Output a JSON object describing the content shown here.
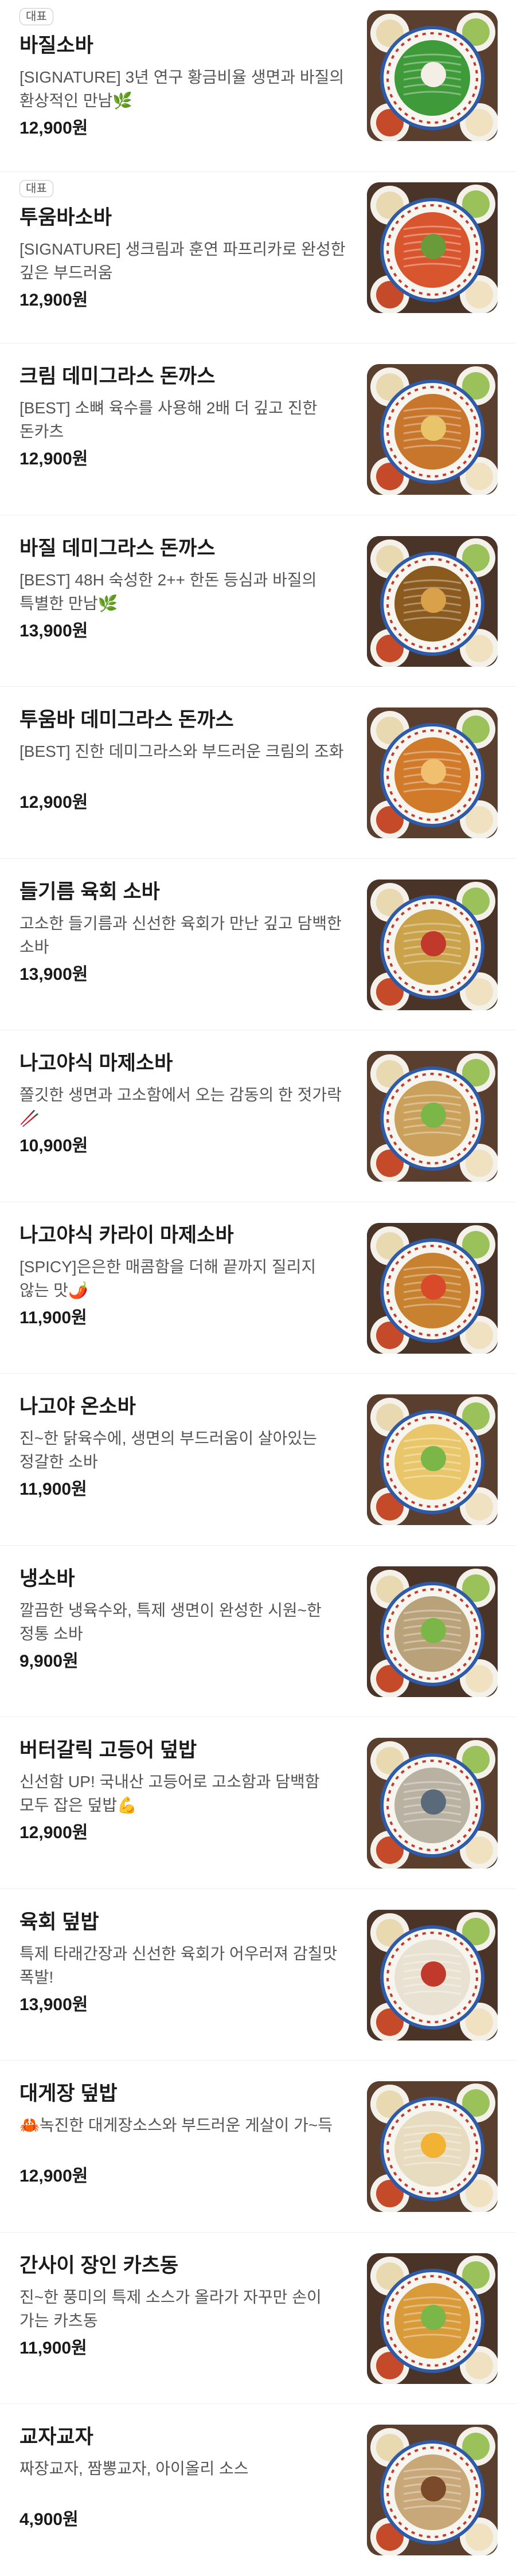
{
  "menu": {
    "items": [
      {
        "badge": "대표",
        "name": "바질소바",
        "desc": "[SIGNATURE] 3년 연구 황금비율 생면과 바질의 환상적인 만남🌿",
        "price": "12,900원",
        "food_color": "#3f9a3a",
        "topping_color": "#f3efe6",
        "image": "basil-soba-image"
      },
      {
        "badge": "대표",
        "name": "투움바소바",
        "desc": "[SIGNATURE] 생크림과 훈연 파프리카로 완성한 깊은 부드러움",
        "price": "12,900원",
        "food_color": "#d9552e",
        "topping_color": "#6a9b3a",
        "image": "toowoomba-soba-image"
      },
      {
        "badge": "",
        "name": "크림 데미그라스 돈까스",
        "desc": "[BEST] 소뼈 육수를 사용해 2배 더 깊고 진한 돈카츠",
        "price": "12,900원",
        "food_color": "#c8762c",
        "topping_color": "#e8c46a",
        "image": "cream-demiglace-tonkatsu-image"
      },
      {
        "badge": "",
        "name": "바질 데미그라스 돈까스",
        "desc": "[BEST] 48H 숙성한 2++ 한돈 등심과 바질의 특별한 만남🌿",
        "price": "13,900원",
        "food_color": "#8a5a1e",
        "topping_color": "#d9a24a",
        "image": "basil-demiglace-tonkatsu-image"
      },
      {
        "badge": "",
        "name": "투움바 데미그라스 돈까스",
        "desc": "[BEST] 진한 데미그라스와 부드러운 크림의 조화",
        "price": "12,900원",
        "food_color": "#d07a2a",
        "topping_color": "#f0c070",
        "image": "toowoomba-demiglace-tonkatsu-image"
      },
      {
        "badge": "",
        "name": "들기름 육회 소바",
        "desc": "고소한 들기름과 신선한 육회가 만난 깊고 담백한 소바",
        "price": "13,900원",
        "food_color": "#c9a24a",
        "topping_color": "#c0392b",
        "image": "perilla-yukhoe-soba-image"
      },
      {
        "badge": "",
        "name": "나고야식 마제소바",
        "desc": "쫄깃한 생면과 고소함에서 오는 감동의 한 젓가락🥢",
        "price": "10,900원",
        "food_color": "#caa05a",
        "topping_color": "#7ab648",
        "image": "nagoya-mazesoba-image"
      },
      {
        "badge": "",
        "name": "나고야식 카라이 마제소바",
        "desc": "[SPICY]은은한 매콤함을 더해 끝까지 질리지 않는 맛🌶️",
        "price": "11,900원",
        "food_color": "#c7812f",
        "topping_color": "#d94a2a",
        "image": "nagoya-karai-mazesoba-image"
      },
      {
        "badge": "",
        "name": "나고야 온소바",
        "desc": "진~한 닭육수에, 생면의 부드러움이 살아있는 정갈한 소바",
        "price": "11,900원",
        "food_color": "#e9c66a",
        "topping_color": "#7ab648",
        "image": "nagoya-onsoba-image"
      },
      {
        "badge": "",
        "name": "냉소바",
        "desc": "깔끔한 냉육수와, 특제 생면이 완성한 시원~한 정통 소바",
        "price": "9,900원",
        "food_color": "#b9a27a",
        "topping_color": "#7ab648",
        "image": "cold-soba-image"
      },
      {
        "badge": "",
        "name": "버터갈릭 고등어 덮밥",
        "desc": "신선함 UP! 국내산 고등어로 고소함과 담백함 모두 잡은 덮밥💪",
        "price": "12,900원",
        "food_color": "#b9b2a2",
        "topping_color": "#5a6a7a",
        "image": "butter-garlic-mackerel-bowl-image"
      },
      {
        "badge": "",
        "name": "육회 덮밥",
        "desc": "특제 타래간장과 신선한 육회가 어우러져 감칠맛 폭발!",
        "price": "13,900원",
        "food_color": "#e9e2d2",
        "topping_color": "#c0392b",
        "image": "yukhoe-bowl-image"
      },
      {
        "badge": "",
        "name": "대게장 덮밥",
        "desc": "🦀녹진한 대게장소스와 부드러운 게살이 가~득",
        "price": "12,900원",
        "food_color": "#e8dcc0",
        "topping_color": "#f2b233",
        "image": "snow-crab-bowl-image"
      },
      {
        "badge": "",
        "name": "간사이 장인 카츠동",
        "desc": "진~한 풍미의 특제 소스가 올라가 자꾸만 손이 가는 카츠동",
        "price": "11,900원",
        "food_color": "#d99a3a",
        "topping_color": "#7ab648",
        "image": "kansai-katsudon-image"
      },
      {
        "badge": "",
        "name": "교자교자",
        "desc": "짜장교자, 짬뽕교자, 아이올리 소스",
        "price": "4,900원",
        "food_color": "#c8a878",
        "topping_color": "#7a4a2a",
        "image": "gyoza-image"
      }
    ]
  }
}
